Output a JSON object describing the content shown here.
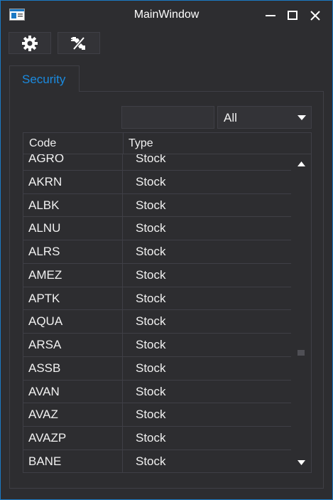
{
  "window": {
    "title": "MainWindow",
    "icon": "app-window-icon",
    "controls": [
      "minimize-icon",
      "maximize-icon",
      "close-icon"
    ],
    "border_color": "#1b79c4"
  },
  "toolbar": {
    "buttons": [
      {
        "icon": "gear-icon"
      },
      {
        "icon": "disconnect-plug-icon"
      }
    ]
  },
  "tabs": [
    {
      "label": "Security",
      "selected": true,
      "color": "#1b8be0"
    }
  ],
  "filter": {
    "search_value": "",
    "type_select": {
      "value": "All"
    }
  },
  "grid": {
    "columns": [
      "Code",
      "Type"
    ],
    "rows": [
      {
        "code": "AGRO",
        "type": "Stock"
      },
      {
        "code": "AKRN",
        "type": "Stock"
      },
      {
        "code": "ALBK",
        "type": "Stock"
      },
      {
        "code": "ALNU",
        "type": "Stock"
      },
      {
        "code": "ALRS",
        "type": "Stock"
      },
      {
        "code": "AMEZ",
        "type": "Stock"
      },
      {
        "code": "APTK",
        "type": "Stock"
      },
      {
        "code": "AQUA",
        "type": "Stock"
      },
      {
        "code": "ARSA",
        "type": "Stock"
      },
      {
        "code": "ASSB",
        "type": "Stock"
      },
      {
        "code": "AVAN",
        "type": "Stock"
      },
      {
        "code": "AVAZ",
        "type": "Stock"
      },
      {
        "code": "AVAZP",
        "type": "Stock"
      },
      {
        "code": "BANE",
        "type": "Stock"
      }
    ]
  }
}
